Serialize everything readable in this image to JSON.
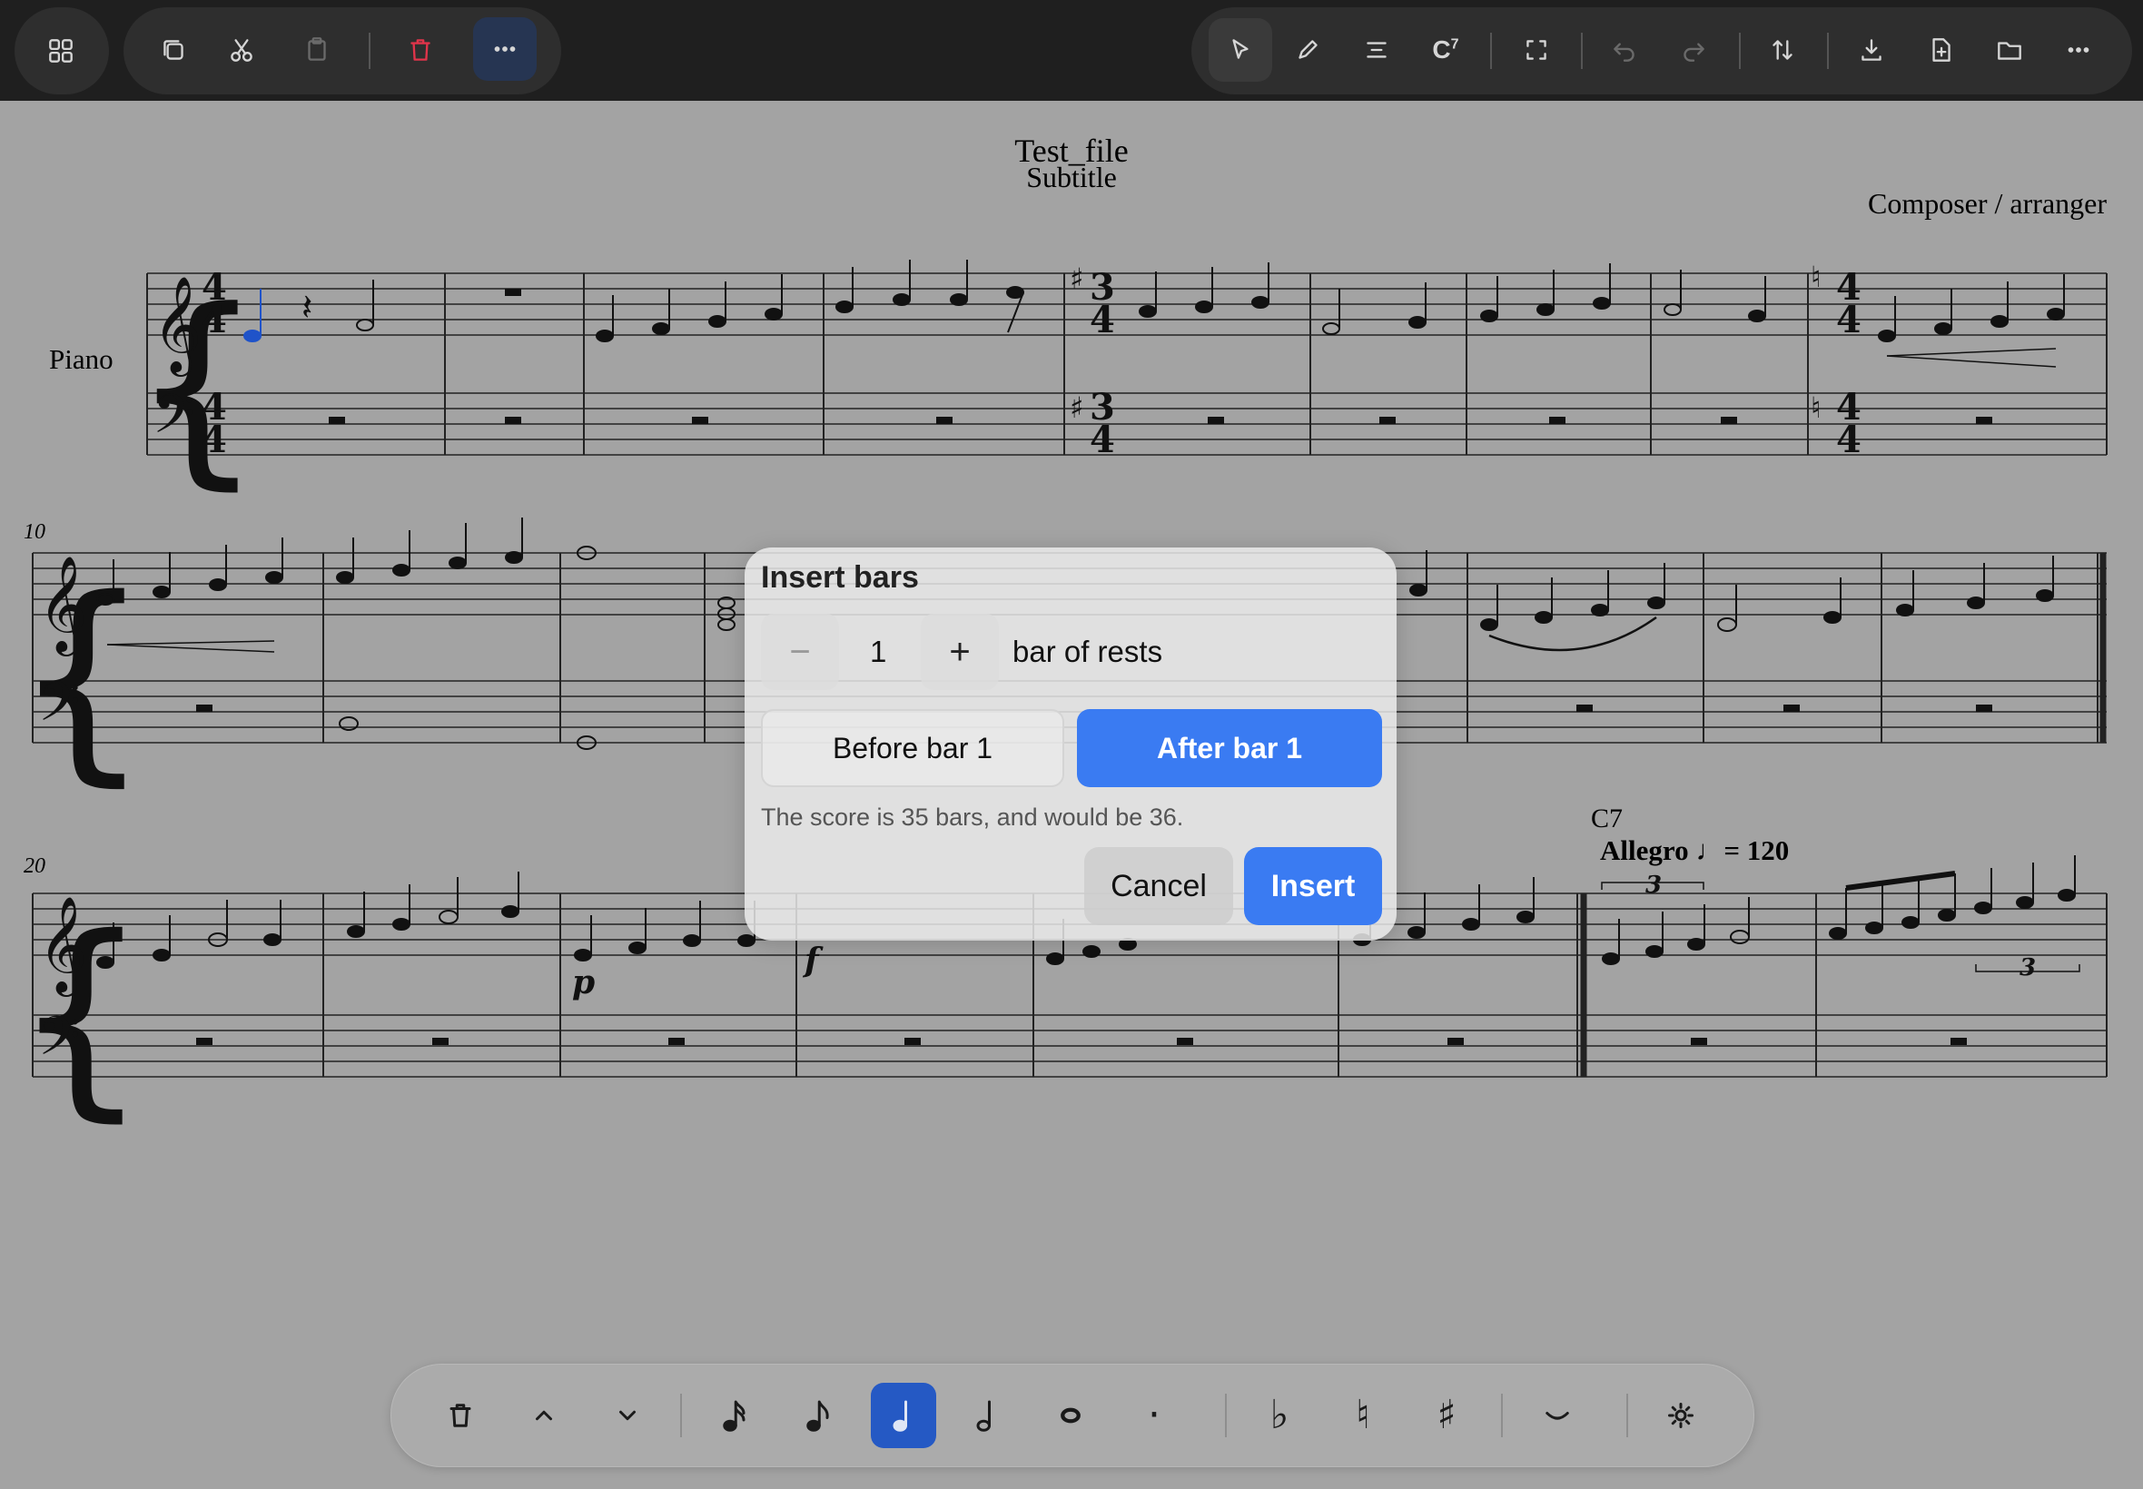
{
  "toolbar": {
    "left": [
      "grid-icon"
    ],
    "edit": [
      "copy-icon",
      "cut-icon",
      "paste-icon",
      "delete-icon",
      "more-icon"
    ],
    "right": [
      "pointer-icon",
      "pencil-icon",
      "align-icon",
      "chord-icon",
      "fullscreen-icon",
      "undo-icon",
      "redo-icon",
      "transpose-icon",
      "download-icon",
      "new-file-icon",
      "folder-icon",
      "more-icon"
    ],
    "chord_label": "C",
    "chord_sup": "7"
  },
  "score": {
    "title": "Test_file",
    "subtitle": "Subtitle",
    "composer": "Composer / arranger",
    "instrument": "Piano",
    "measure_numbers": [
      "10",
      "20"
    ],
    "chord_symbol": "C7",
    "tempo": "Allegro ♩= 120",
    "time_signatures": [
      "4/4",
      "3/4",
      "4/4"
    ],
    "tuplet": "3",
    "dynamics": [
      "p",
      "f"
    ]
  },
  "dialog": {
    "title": "Insert bars",
    "minus_label": "−",
    "plus_label": "+",
    "count": "1",
    "unit": "bar of rests",
    "before_label": "Before bar 1",
    "after_label": "After bar 1",
    "selected": "after",
    "note": "The score is 35 bars, and would be 36.",
    "cancel_label": "Cancel",
    "insert_label": "Insert"
  },
  "bottombar": {
    "items": [
      "trash-icon",
      "up-icon",
      "down-icon",
      "sixteenth-note-icon",
      "eighth-note-icon",
      "quarter-note-icon",
      "half-note-icon",
      "whole-note-icon",
      "dot-icon",
      "flat-icon",
      "natural-icon",
      "sharp-icon",
      "tie-icon",
      "settings-icon"
    ],
    "selected": "quarter-note-icon",
    "glyphs": {
      "flat": "♭",
      "natural": "♮",
      "sharp": "♯",
      "dot": "·"
    }
  },
  "colors": {
    "topbar": "#1f1f1f",
    "page": "#a3a3a3",
    "accent": "#3a7bf2",
    "delete": "#e0344a",
    "selected_note": "#1f53c9"
  }
}
